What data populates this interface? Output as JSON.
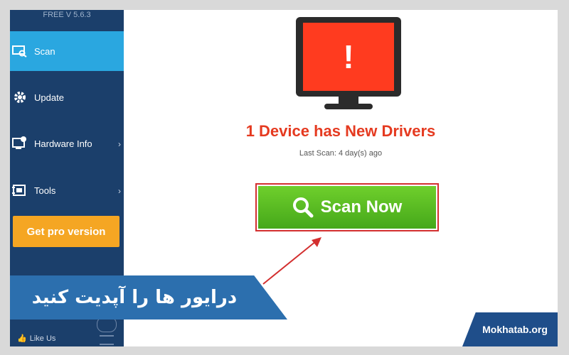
{
  "sidebar": {
    "version": "FREE V 5.6.3",
    "items": [
      {
        "label": "Scan",
        "icon": "scan-icon",
        "active": true,
        "chevron": false
      },
      {
        "label": "Update",
        "icon": "gear-icon",
        "active": false,
        "chevron": false
      },
      {
        "label": "Hardware Info",
        "icon": "hardware-info-icon",
        "active": false,
        "chevron": true
      },
      {
        "label": "Tools",
        "icon": "tools-icon",
        "active": false,
        "chevron": true
      }
    ],
    "pro_button": "Get pro version",
    "like_us": "Like Us"
  },
  "main": {
    "headline": "1 Device has New Drivers",
    "last_scan": "Last Scan: 4 day(s) ago",
    "scan_button": "Scan Now",
    "alert_symbol": "!"
  },
  "banner": {
    "text": "درایور ها را آپدیت کنید"
  },
  "brand": {
    "text": "Mokhatab.org"
  },
  "colors": {
    "sidebar_bg": "#1b3f6b",
    "active_item": "#2aa7e0",
    "pro_button": "#f5a623",
    "headline": "#e53a20",
    "scan_button": "#45a81a",
    "banner": "#2c6fae",
    "brand_tab": "#1f4e8a"
  }
}
